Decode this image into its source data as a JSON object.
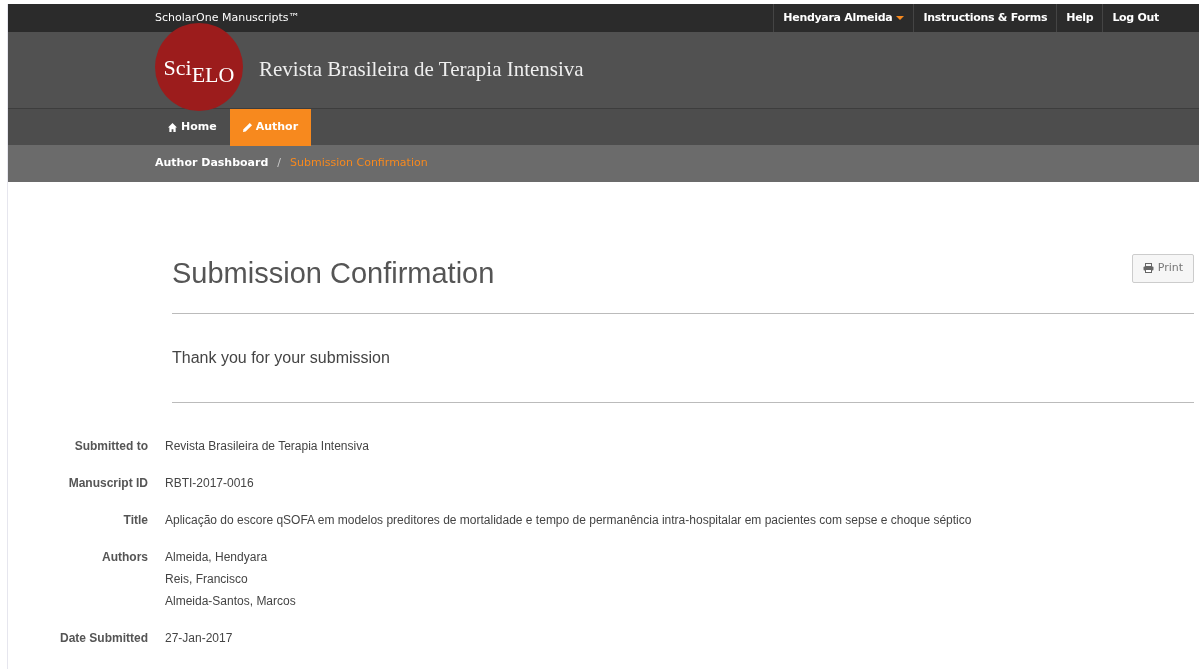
{
  "top_bar": {
    "brand": "ScholarOne Manuscripts™",
    "user_menu": "Hendyara Almeida",
    "links": [
      "Instructions & Forms",
      "Help",
      "Log Out"
    ]
  },
  "header": {
    "logo": {
      "part_1": "Sci",
      "part_2": "ELO"
    },
    "journal_title": "Revista Brasileira de Terapia Intensiva"
  },
  "nav_tabs": [
    {
      "label": "Home",
      "selected": false
    },
    {
      "label": "Author",
      "selected": true
    }
  ],
  "breadcrumb": {
    "separator": "/",
    "items": [
      {
        "label": "Author Dashboard",
        "current": false
      },
      {
        "label": "Submission Confirmation",
        "current": true
      }
    ]
  },
  "page_title": "Submission Confirmation",
  "print_button": "Print",
  "message": "Thank you for your submission",
  "details": [
    {
      "label": "Submitted to",
      "values": [
        "Revista Brasileira de Terapia Intensiva"
      ]
    },
    {
      "label": "Manuscript ID",
      "values": [
        "RBTI-2017-0016"
      ]
    },
    {
      "label": "Title",
      "values": [
        "Aplicação do escore qSOFA em modelos preditores de mortalidade e tempo de permanência intra-hospitalar em pacientes com sepse e choque séptico"
      ]
    },
    {
      "label": "Authors",
      "values": [
        "Almeida, Hendyara",
        "Reis, Francisco",
        "Almeida-Santos, Marcos"
      ]
    },
    {
      "label": "Date Submitted",
      "values": [
        "27-Jan-2017"
      ]
    }
  ]
}
